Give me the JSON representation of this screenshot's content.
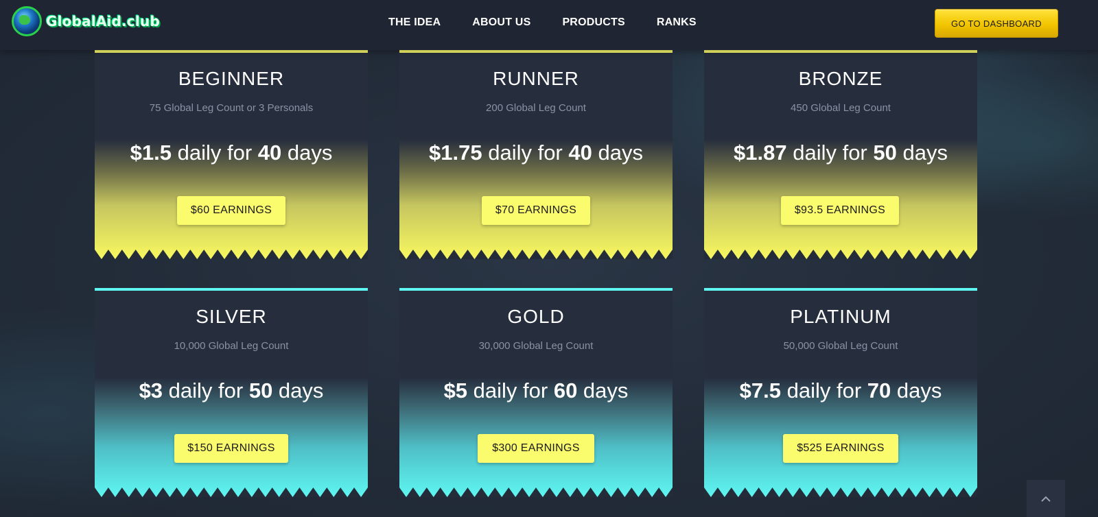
{
  "brand": {
    "name": "GlobalAid.club"
  },
  "nav": {
    "items": [
      "THE IDEA",
      "ABOUT US",
      "PRODUCTS",
      "RANKS"
    ],
    "dashboard_label": "GO TO DASHBOARD"
  },
  "ranks": [
    {
      "title": "BEGINNER",
      "requirement": "75 Global Leg Count or 3 Personals",
      "amount": "$1.5",
      "mid": " daily for ",
      "days": "40",
      "tail": " days",
      "earnings": "$60 EARNINGS",
      "theme": "yellow"
    },
    {
      "title": "RUNNER",
      "requirement": "200 Global Leg Count",
      "amount": "$1.75",
      "mid": " daily for ",
      "days": "40",
      "tail": " days",
      "earnings": "$70 EARNINGS",
      "theme": "yellow"
    },
    {
      "title": "BRONZE",
      "requirement": "450 Global Leg Count",
      "amount": "$1.87",
      "mid": " daily for ",
      "days": "50",
      "tail": " days",
      "earnings": "$93.5 EARNINGS",
      "theme": "yellow"
    },
    {
      "title": "SILVER",
      "requirement": "10,000 Global Leg Count",
      "amount": "$3",
      "mid": " daily for ",
      "days": "50",
      "tail": " days",
      "earnings": "$150 EARNINGS",
      "theme": "cyan"
    },
    {
      "title": "GOLD",
      "requirement": "30,000 Global Leg Count",
      "amount": "$5",
      "mid": " daily for ",
      "days": "60",
      "tail": " days",
      "earnings": "$300 EARNINGS",
      "theme": "cyan"
    },
    {
      "title": "PLATINUM",
      "requirement": "50,000 Global Leg Count",
      "amount": "$7.5",
      "mid": " daily for ",
      "days": "70",
      "tail": " days",
      "earnings": "$525 EARNINGS",
      "theme": "cyan"
    }
  ],
  "colors": {
    "yellow": "#fbfb6d",
    "cyan": "#5ff5f0",
    "header_bg": "#1f2532",
    "card_bg": "#262d3d"
  },
  "icons": {
    "logo": "globe-icon",
    "scroll_top": "chevron-up-icon"
  }
}
